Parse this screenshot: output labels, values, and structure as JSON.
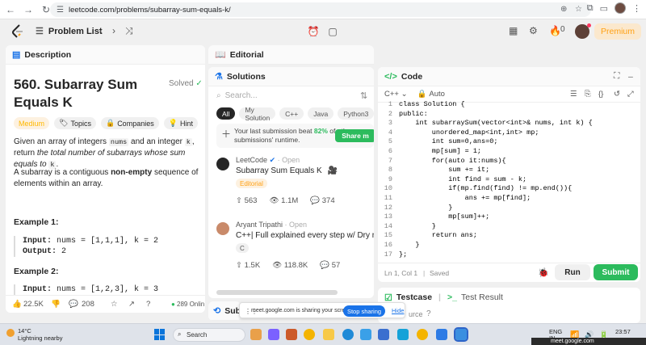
{
  "browser": {
    "url": "leetcode.com/problems/subarray-sum-equals-k/"
  },
  "topbar": {
    "problem_list_label": "Problem List",
    "streak_count": "0",
    "premium_label": "Premium"
  },
  "description": {
    "tab_label": "Description",
    "title": "560. Subarray Sum Equals K",
    "status": "Solved",
    "chips": {
      "difficulty": "Medium",
      "topics": "Topics",
      "companies": "Companies",
      "hint": "Hint"
    },
    "para1_a": "Given an array of integers ",
    "para1_code1": "nums",
    "para1_b": " and an integer ",
    "para1_code2": "k",
    "para1_c": ", return ",
    "para1_d": "the total number of subarrays whose sum equals to ",
    "para1_code3": "k",
    "para1_e": ".",
    "para2_a": "A subarray is a contiguous ",
    "para2_b": "non-empty",
    "para2_c": " sequence of elements within an array.",
    "example1_heading": "Example 1:",
    "example1_input_label": "Input:",
    "example1_input": " nums = [1,1,1], k = 2",
    "example1_output_label": "Output:",
    "example1_output": " 2",
    "example2_heading": "Example 2:",
    "example2_input_label": "Input:",
    "example2_input": " nums = [1,2,3], k = 3",
    "footer": {
      "likes": "22.5K",
      "comments": "208",
      "online": "289 Onlin"
    }
  },
  "editorial": {
    "tab_label": "Editorial"
  },
  "solutions": {
    "tab_label": "Solutions",
    "search_placeholder": "Search...",
    "tags": [
      "All",
      "My Solution",
      "C++",
      "Java",
      "Python3"
    ],
    "beat_text_a": "Your last submission beat ",
    "beat_pct": "82%",
    "beat_text_b": " of other submissions' runtime.",
    "share_label": "Share m",
    "posts": [
      {
        "author": "LeetCode",
        "status": "Open",
        "title": "Subarray Sum Equals K",
        "tag": "Editorial",
        "likes": "563",
        "views": "1.1M",
        "comments": "374"
      },
      {
        "author": "Aryant Tripathi",
        "status": "Open",
        "title": "C++| Full explained every step w/ Dry run",
        "tag": "C",
        "likes": "1.5K",
        "views": "118.8K",
        "comments": "57"
      }
    ],
    "bottom_tab_label": "Sub"
  },
  "code": {
    "tab_label": "Code",
    "language": "C++",
    "mode": "Auto",
    "lines": [
      {
        "n": "1",
        "t": "class Solution {"
      },
      {
        "n": "2",
        "t": "public:"
      },
      {
        "n": "3",
        "t": "    int subarraySum(vector<int>& nums, int k) {"
      },
      {
        "n": "4",
        "t": "        unordered_map<int,int> mp;"
      },
      {
        "n": "5",
        "t": "        int sum=0,ans=0;"
      },
      {
        "n": "6",
        "t": "        mp[sum] = 1;"
      },
      {
        "n": "7",
        "t": "        for(auto it:nums){"
      },
      {
        "n": "8",
        "t": "            sum += it;"
      },
      {
        "n": "9",
        "t": "            int find = sum - k;"
      },
      {
        "n": "10",
        "t": "            if(mp.find(find) != mp.end()){"
      },
      {
        "n": "11",
        "t": "                ans += mp[find];"
      },
      {
        "n": "12",
        "t": "            }"
      },
      {
        "n": "13",
        "t": "            mp[sum]++;"
      },
      {
        "n": "14",
        "t": "        }"
      },
      {
        "n": "15",
        "t": "        return ans;"
      },
      {
        "n": "16",
        "t": "    }"
      },
      {
        "n": "17",
        "t": "};"
      }
    ],
    "cursor_pos": "Ln 1, Col 1",
    "saved_label": "Saved",
    "run_label": "Run",
    "submit_label": "Submit"
  },
  "testcase": {
    "tab_label": "Testcase",
    "result_label": "Test Result",
    "source_label": "urce"
  },
  "sharebar": {
    "message": "meet.google.com is sharing your screen.",
    "stop_label": "Stop sharing",
    "hide_label": "Hide"
  },
  "taskbar": {
    "weather_temp": "14°C",
    "weather_desc": "Lightning nearby",
    "search_label": "Search",
    "lang_a": "ENG",
    "lang_b": "IN",
    "time": "23:57",
    "meet_tip": "meet.google.com"
  },
  "colors": {
    "accent_green": "#2cbb5d",
    "premium_orange": "#ffa116",
    "medium_yellow": "#ffb800",
    "stop_blue": "#1a73e8"
  }
}
